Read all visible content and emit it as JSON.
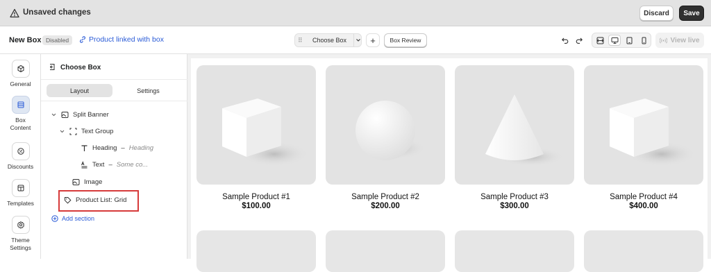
{
  "topbar": {
    "title": "Unsaved changes",
    "discard": "Discard",
    "save": "Save"
  },
  "toolbar": {
    "box_name": "New Box",
    "status_badge": "Disabled",
    "link_text": "Product linked with box",
    "chooser_label": "Choose Box",
    "review_label": "Box Review",
    "view_live": "View live"
  },
  "rail": [
    {
      "label": "General",
      "icon": "cube-icon",
      "active": false
    },
    {
      "label": "Box\nContent",
      "icon": "layout-icon",
      "active": true
    },
    {
      "label": "Discounts",
      "icon": "discount-icon",
      "active": false
    },
    {
      "label": "Templates",
      "icon": "template-icon",
      "active": false
    },
    {
      "label": "Theme\nSettings",
      "icon": "gear-icon",
      "active": false
    }
  ],
  "panel": {
    "title": "Choose Box",
    "tabs": [
      "Layout",
      "Settings"
    ],
    "tree": {
      "split_banner": "Split Banner",
      "text_group": "Text Group",
      "heading": "Heading",
      "heading_sep": "–",
      "heading_val": "Heading",
      "text": "Text",
      "text_sep": "–",
      "text_val": "Some co...",
      "image": "Image",
      "product_list": "Product List: Grid"
    },
    "add_section": "Add section"
  },
  "products": [
    {
      "name": "Sample Product #1",
      "price": "$100.00",
      "shape": "cube"
    },
    {
      "name": "Sample Product #2",
      "price": "$200.00",
      "shape": "sphere"
    },
    {
      "name": "Sample Product #3",
      "price": "$300.00",
      "shape": "cone"
    },
    {
      "name": "Sample Product #4",
      "price": "$400.00",
      "shape": "cube"
    }
  ],
  "colors": {
    "accent": "#2a5bd7",
    "highlight": "#d63a3a",
    "save_bg": "#303030"
  }
}
